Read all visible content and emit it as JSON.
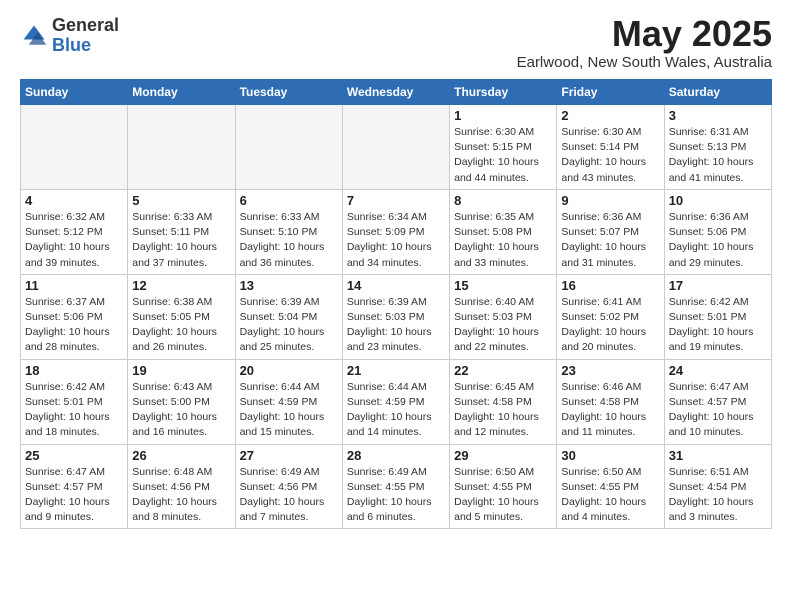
{
  "logo": {
    "general": "General",
    "blue": "Blue"
  },
  "title": {
    "month_year": "May 2025",
    "location": "Earlwood, New South Wales, Australia"
  },
  "weekdays": [
    "Sunday",
    "Monday",
    "Tuesday",
    "Wednesday",
    "Thursday",
    "Friday",
    "Saturday"
  ],
  "weeks": [
    [
      {
        "day": "",
        "info": ""
      },
      {
        "day": "",
        "info": ""
      },
      {
        "day": "",
        "info": ""
      },
      {
        "day": "",
        "info": ""
      },
      {
        "day": "1",
        "info": "Sunrise: 6:30 AM\nSunset: 5:15 PM\nDaylight: 10 hours\nand 44 minutes."
      },
      {
        "day": "2",
        "info": "Sunrise: 6:30 AM\nSunset: 5:14 PM\nDaylight: 10 hours\nand 43 minutes."
      },
      {
        "day": "3",
        "info": "Sunrise: 6:31 AM\nSunset: 5:13 PM\nDaylight: 10 hours\nand 41 minutes."
      }
    ],
    [
      {
        "day": "4",
        "info": "Sunrise: 6:32 AM\nSunset: 5:12 PM\nDaylight: 10 hours\nand 39 minutes."
      },
      {
        "day": "5",
        "info": "Sunrise: 6:33 AM\nSunset: 5:11 PM\nDaylight: 10 hours\nand 37 minutes."
      },
      {
        "day": "6",
        "info": "Sunrise: 6:33 AM\nSunset: 5:10 PM\nDaylight: 10 hours\nand 36 minutes."
      },
      {
        "day": "7",
        "info": "Sunrise: 6:34 AM\nSunset: 5:09 PM\nDaylight: 10 hours\nand 34 minutes."
      },
      {
        "day": "8",
        "info": "Sunrise: 6:35 AM\nSunset: 5:08 PM\nDaylight: 10 hours\nand 33 minutes."
      },
      {
        "day": "9",
        "info": "Sunrise: 6:36 AM\nSunset: 5:07 PM\nDaylight: 10 hours\nand 31 minutes."
      },
      {
        "day": "10",
        "info": "Sunrise: 6:36 AM\nSunset: 5:06 PM\nDaylight: 10 hours\nand 29 minutes."
      }
    ],
    [
      {
        "day": "11",
        "info": "Sunrise: 6:37 AM\nSunset: 5:06 PM\nDaylight: 10 hours\nand 28 minutes."
      },
      {
        "day": "12",
        "info": "Sunrise: 6:38 AM\nSunset: 5:05 PM\nDaylight: 10 hours\nand 26 minutes."
      },
      {
        "day": "13",
        "info": "Sunrise: 6:39 AM\nSunset: 5:04 PM\nDaylight: 10 hours\nand 25 minutes."
      },
      {
        "day": "14",
        "info": "Sunrise: 6:39 AM\nSunset: 5:03 PM\nDaylight: 10 hours\nand 23 minutes."
      },
      {
        "day": "15",
        "info": "Sunrise: 6:40 AM\nSunset: 5:03 PM\nDaylight: 10 hours\nand 22 minutes."
      },
      {
        "day": "16",
        "info": "Sunrise: 6:41 AM\nSunset: 5:02 PM\nDaylight: 10 hours\nand 20 minutes."
      },
      {
        "day": "17",
        "info": "Sunrise: 6:42 AM\nSunset: 5:01 PM\nDaylight: 10 hours\nand 19 minutes."
      }
    ],
    [
      {
        "day": "18",
        "info": "Sunrise: 6:42 AM\nSunset: 5:01 PM\nDaylight: 10 hours\nand 18 minutes."
      },
      {
        "day": "19",
        "info": "Sunrise: 6:43 AM\nSunset: 5:00 PM\nDaylight: 10 hours\nand 16 minutes."
      },
      {
        "day": "20",
        "info": "Sunrise: 6:44 AM\nSunset: 4:59 PM\nDaylight: 10 hours\nand 15 minutes."
      },
      {
        "day": "21",
        "info": "Sunrise: 6:44 AM\nSunset: 4:59 PM\nDaylight: 10 hours\nand 14 minutes."
      },
      {
        "day": "22",
        "info": "Sunrise: 6:45 AM\nSunset: 4:58 PM\nDaylight: 10 hours\nand 12 minutes."
      },
      {
        "day": "23",
        "info": "Sunrise: 6:46 AM\nSunset: 4:58 PM\nDaylight: 10 hours\nand 11 minutes."
      },
      {
        "day": "24",
        "info": "Sunrise: 6:47 AM\nSunset: 4:57 PM\nDaylight: 10 hours\nand 10 minutes."
      }
    ],
    [
      {
        "day": "25",
        "info": "Sunrise: 6:47 AM\nSunset: 4:57 PM\nDaylight: 10 hours\nand 9 minutes."
      },
      {
        "day": "26",
        "info": "Sunrise: 6:48 AM\nSunset: 4:56 PM\nDaylight: 10 hours\nand 8 minutes."
      },
      {
        "day": "27",
        "info": "Sunrise: 6:49 AM\nSunset: 4:56 PM\nDaylight: 10 hours\nand 7 minutes."
      },
      {
        "day": "28",
        "info": "Sunrise: 6:49 AM\nSunset: 4:55 PM\nDaylight: 10 hours\nand 6 minutes."
      },
      {
        "day": "29",
        "info": "Sunrise: 6:50 AM\nSunset: 4:55 PM\nDaylight: 10 hours\nand 5 minutes."
      },
      {
        "day": "30",
        "info": "Sunrise: 6:50 AM\nSunset: 4:55 PM\nDaylight: 10 hours\nand 4 minutes."
      },
      {
        "day": "31",
        "info": "Sunrise: 6:51 AM\nSunset: 4:54 PM\nDaylight: 10 hours\nand 3 minutes."
      }
    ]
  ]
}
